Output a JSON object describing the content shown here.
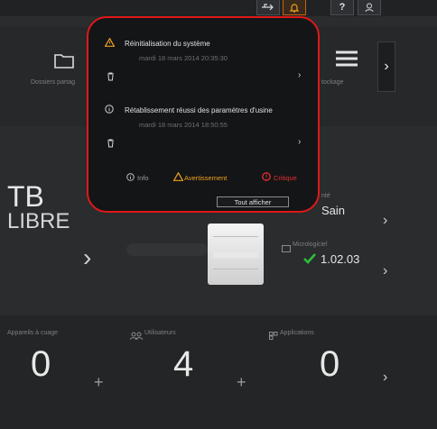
{
  "topbar": {
    "icons": [
      "usb-icon",
      "alert-bell-icon",
      "help-icon",
      "user-icon"
    ],
    "help_label": "?"
  },
  "tiles": {
    "shares_label": "Dossiers partag",
    "storage_label": "tockage",
    "free_capacity_unit": "TB",
    "free_label": "LIBRE",
    "health_label": "nté",
    "health_value": "Sain",
    "firmware_label": "Micrologiciel",
    "firmware_value": "1.02.03",
    "cloud_devices_label": "Appareils à cuage",
    "cloud_devices_count": "0",
    "users_label": "Utilisateurs",
    "users_count": "4",
    "apps_label": "Applications",
    "apps_count": "0"
  },
  "alerts_popup": {
    "items": [
      {
        "icon": "warning-icon",
        "title": "Réinitialisation du système",
        "date": "mardi 18 mars 2014 20:35:30"
      },
      {
        "icon": "info-icon",
        "title": "Rétablissement réussi des paramètres d'usine",
        "date": "mardi 18 mars 2014 18:50:55"
      }
    ],
    "legend_info": "Info",
    "legend_warning": "Avertissement",
    "legend_critical": "Critique",
    "show_all": "Tout afficher"
  },
  "colors": {
    "highlight": "#e01818",
    "warning": "#f0a020",
    "critical": "#e03030",
    "success": "#2fbf3a"
  }
}
